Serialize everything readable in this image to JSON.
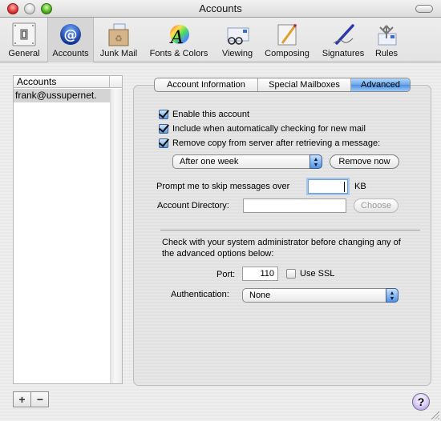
{
  "window": {
    "title": "Accounts"
  },
  "toolbar": {
    "items": [
      {
        "label": "General",
        "icon": "light-switch-icon",
        "selected": false
      },
      {
        "label": "Accounts",
        "icon": "at-sign-icon",
        "selected": true
      },
      {
        "label": "Junk Mail",
        "icon": "recycle-box-icon",
        "selected": false
      },
      {
        "label": "Fonts & Colors",
        "icon": "color-wheel-font-icon",
        "selected": false
      },
      {
        "label": "Viewing",
        "icon": "glasses-envelope-icon",
        "selected": false
      },
      {
        "label": "Composing",
        "icon": "pencil-paper-icon",
        "selected": false
      },
      {
        "label": "Signatures",
        "icon": "fountain-pen-icon",
        "selected": false
      },
      {
        "label": "Rules",
        "icon": "arrows-envelope-icon",
        "selected": false
      }
    ]
  },
  "accounts_list": {
    "header": "Accounts",
    "rows": [
      "frank@ussupernet."
    ],
    "add_label": "+",
    "remove_label": "−"
  },
  "tabs": [
    {
      "label": "Account Information",
      "selected": false
    },
    {
      "label": "Special Mailboxes",
      "selected": false
    },
    {
      "label": "Advanced",
      "selected": true
    }
  ],
  "advanced": {
    "enable_account": {
      "label": "Enable this account",
      "checked": true
    },
    "include_auto_check": {
      "label": "Include when automatically checking for new mail",
      "checked": true
    },
    "remove_copy": {
      "label": "Remove copy from server after retrieving a message:",
      "checked": true
    },
    "remove_when": {
      "value": "After one week"
    },
    "remove_now_label": "Remove now",
    "prompt_skip_label": "Prompt me to skip messages over",
    "prompt_skip_value": "",
    "prompt_skip_unit": "KB",
    "account_directory_label": "Account Directory:",
    "account_directory_value": "",
    "choose_label": "Choose",
    "warning_text_line1": "Check with your system administrator before changing any of",
    "warning_text_line2": "the advanced options below:",
    "port_label": "Port:",
    "port_value": "110",
    "use_ssl": {
      "label": "Use SSL",
      "checked": false
    },
    "authentication_label": "Authentication:",
    "authentication_value": "None"
  },
  "help_label": "?"
}
